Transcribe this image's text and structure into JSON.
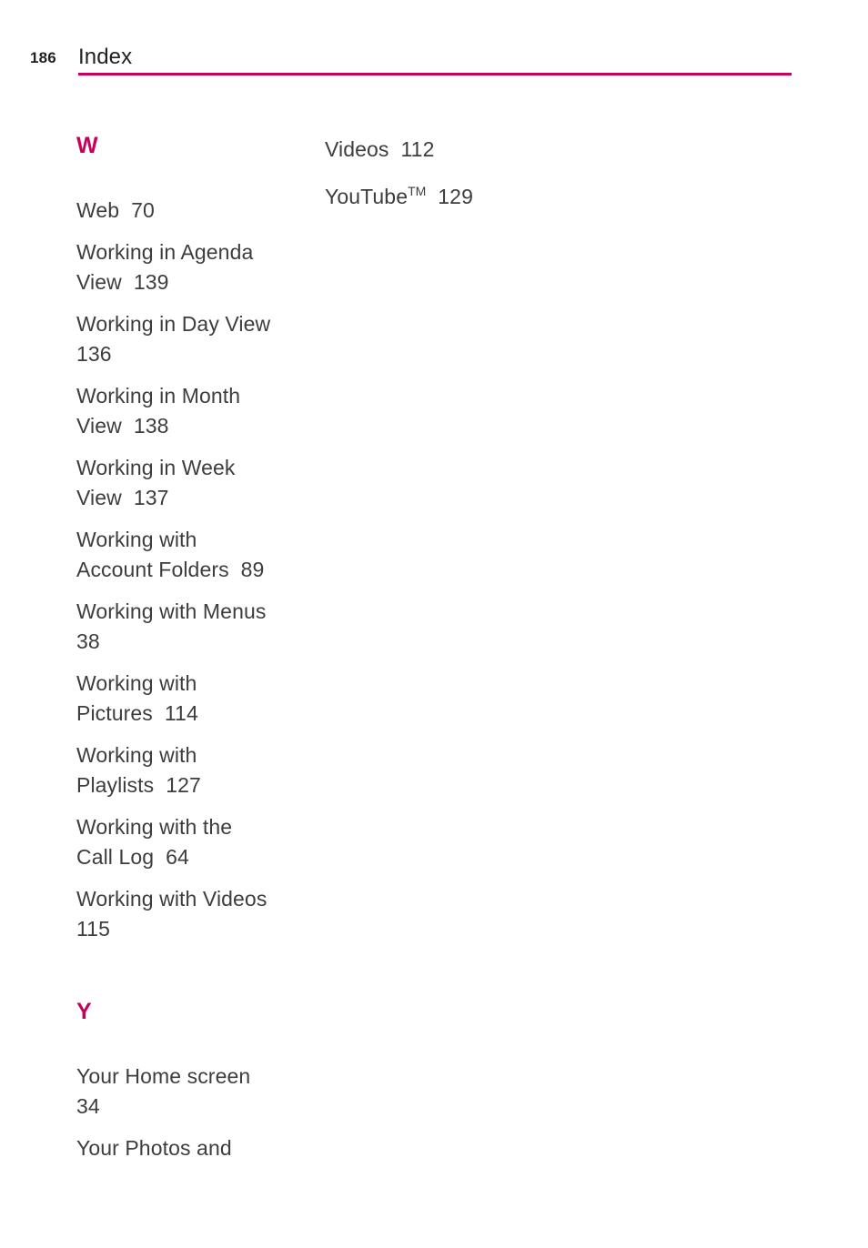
{
  "header": {
    "folio": "186",
    "title": "Index",
    "rule_color": "#c8005a"
  },
  "colors": {
    "accent": "#c8005a",
    "body_text": "#3d3d3d",
    "header_text": "#231f20"
  },
  "columns": {
    "left": {
      "sections": [
        {
          "letter": "W",
          "entries": [
            {
              "text": "Web  70"
            },
            {
              "text": "Working in Agenda\nView  139"
            },
            {
              "text": "Working in Day View\n136"
            },
            {
              "text": "Working in Month\nView  138"
            },
            {
              "text": "Working in Week\nView  137"
            },
            {
              "text": "Working with\nAccount Folders  89"
            },
            {
              "text": "Working with Menus\n38"
            },
            {
              "text": "Working with\nPictures  114"
            },
            {
              "text": "Working with\nPlaylists  127"
            },
            {
              "text": "Working with the\nCall Log  64"
            },
            {
              "text": "Working with Videos\n115"
            }
          ]
        },
        {
          "letter": "Y",
          "entries": [
            {
              "text": "Your Home screen\n34"
            },
            {
              "text": "Your Photos and"
            }
          ]
        }
      ]
    },
    "right": {
      "entries": [
        {
          "text": "Videos  112"
        },
        {
          "text_before_tm": "YouTube",
          "tm": "TM",
          "text_after_tm": "  129"
        }
      ]
    }
  }
}
